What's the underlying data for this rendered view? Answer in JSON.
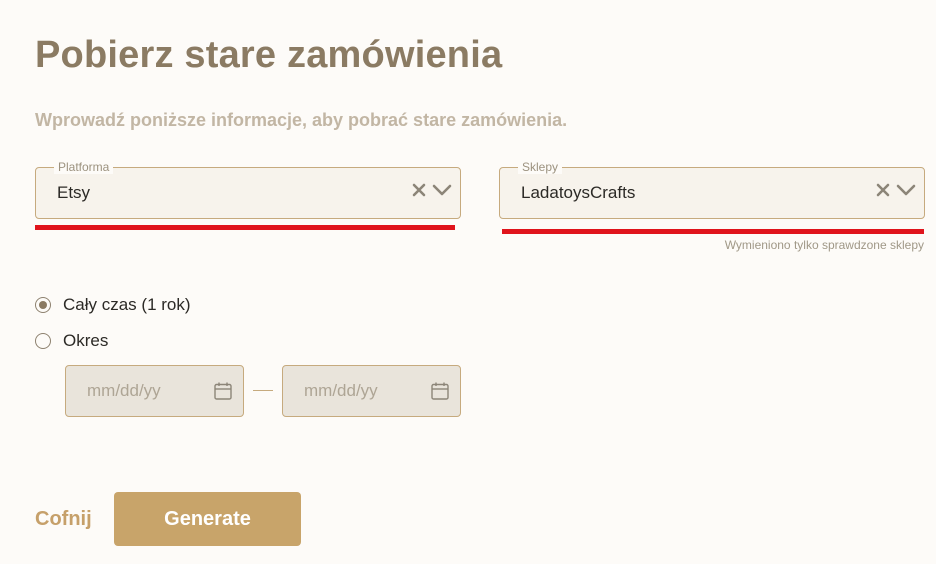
{
  "page": {
    "title": "Pobierz stare zamówienia",
    "subtitle": "Wprowadź poniższe informacje, aby pobrać stare zamówienia."
  },
  "platform": {
    "legend": "Platforma",
    "value": "Etsy"
  },
  "stores": {
    "legend": "Sklepy",
    "value": "LadatoysCrafts",
    "hint": "Wymieniono tylko sprawdzone sklepy"
  },
  "period": {
    "options": [
      {
        "label": "Cały czas (1 rok)",
        "selected": true
      },
      {
        "label": "Okres",
        "selected": false
      }
    ],
    "from_placeholder": "mm/dd/yy",
    "to_placeholder": "mm/dd/yy"
  },
  "actions": {
    "back_label": "Cofnij",
    "generate_label": "Generate"
  },
  "colors": {
    "accent": "#c8a46a",
    "title": "#8b7b63",
    "highlight_underline": "#e0141c",
    "field_border": "#c6aa7e"
  },
  "icons": {
    "clear": "clear-icon",
    "dropdown": "chevron-down-icon",
    "calendar": "calendar-icon"
  }
}
